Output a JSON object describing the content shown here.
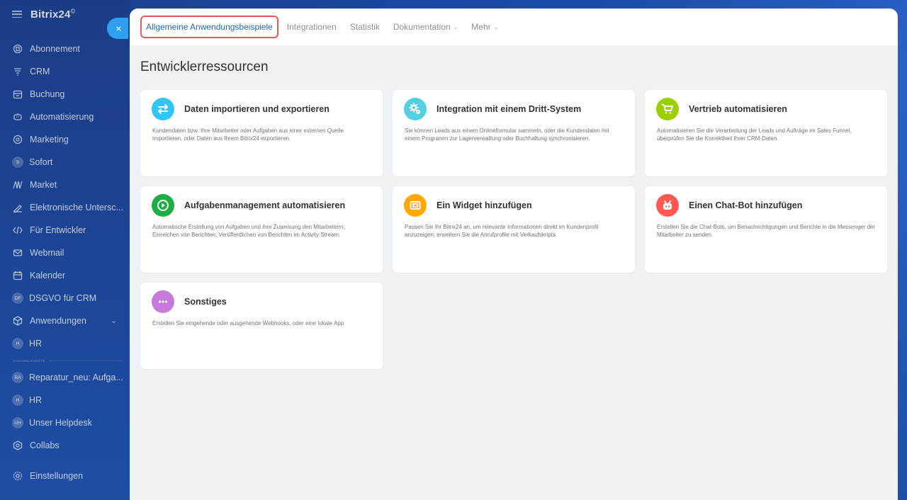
{
  "sidebar": {
    "logo": "Bitrix24",
    "logo_mark": "©",
    "items": [
      {
        "label": "Abonnement",
        "icon": "subscription-icon"
      },
      {
        "label": "CRM",
        "icon": "crm-icon"
      },
      {
        "label": "Buchung",
        "icon": "calendar-booking-icon"
      },
      {
        "label": "Automatisierung",
        "icon": "robot-icon"
      },
      {
        "label": "Marketing",
        "icon": "marketing-icon"
      },
      {
        "label": "Sofort",
        "icon": "s-badge",
        "badge": "S"
      },
      {
        "label": "Market",
        "icon": "market-icon"
      },
      {
        "label": "Elektronische Untersc...",
        "icon": "signature-icon"
      },
      {
        "label": "Für Entwickler",
        "icon": "code-icon"
      },
      {
        "label": "Webmail",
        "icon": "mail-icon"
      },
      {
        "label": "Kalender",
        "icon": "calendar-icon"
      },
      {
        "label": "DSGVO für CRM",
        "icon": "df-badge",
        "badge": "DF"
      },
      {
        "label": "Anwendungen",
        "icon": "apps-icon",
        "chevron": "⌄"
      },
      {
        "label": "HR",
        "icon": "h-badge",
        "badge": "H"
      }
    ],
    "divider_label": "AUSGEBLENDETE",
    "hidden_items": [
      {
        "label": "Reparatur_neu: Aufga...",
        "badge": "RA"
      },
      {
        "label": "HR",
        "badge": "H"
      },
      {
        "label": "Unser Helpdesk",
        "badge": "UH"
      },
      {
        "label": "Collabs",
        "icon": "collabs-icon"
      }
    ],
    "settings_label": "Einstellungen"
  },
  "close_button": "×",
  "topnav": {
    "tabs": [
      {
        "label": "Allgemeine Anwendungsbeispiele",
        "active": true
      },
      {
        "label": "Integrationen"
      },
      {
        "label": "Statistik"
      },
      {
        "label": "Dokumentation",
        "caret": "⌄"
      },
      {
        "label": "Mehr",
        "caret": "⌄"
      }
    ]
  },
  "page_title": "Entwicklerressourcen",
  "cards": [
    {
      "title": "Daten importieren und exportieren",
      "desc": "Kundendaten bzw. Ihre Mitarbeiter oder Aufgaben aus einer externen Quelle importieren, oder Daten aus Ihrem Bitrix24 exportieren.",
      "icon": "arrows-exchange-icon",
      "color": "#2fc6f6"
    },
    {
      "title": "Integration mit einem Dritt-System",
      "desc": "Sie können Leads aus einem Onlineformular sammeln, oder die Kundendaten mit einem Programm zur Lagerverwaltung oder Buchhaltung synchronisieren.",
      "icon": "gears-icon",
      "color": "#55d0e0"
    },
    {
      "title": "Vertrieb automatisieren",
      "desc": "Automatisieren Sie die Verarbeitung der Leads und Aufträge im Sales Funnel, überprüfen Sie die Korrektheit Ihrer CRM-Daten.",
      "icon": "cart-icon",
      "color": "#9dcf00"
    },
    {
      "title": "Aufgabenmanagement automatisieren",
      "desc": "Automatische Erstellung von Aufgaben und ihre Zuweisung den Mitarbeitern; Einreichen von Berichten; Veröffentlichen von Berichten im Activity Stream.",
      "icon": "play-icon",
      "color": "#1eae43"
    },
    {
      "title": "Ein Widget hinzufügen",
      "desc": "Passen Sie Ihr Bitrix24 an, um relevante Informationen direkt im Kundenprofil anzuzeigen; erweitern Sie die Anrufprofile mit Verkaufskripts.",
      "icon": "widget-icon",
      "color": "#ffa900"
    },
    {
      "title": "Einen Chat-Bot hinzufügen",
      "desc": "Erstellen Sie die Chat-Bots, um Benachrichtigungen und Berichte in die Messenger der Mitarbeiter zu senden.",
      "icon": "bot-icon",
      "color": "#ff5752"
    },
    {
      "title": "Sonstiges",
      "desc": "Erstellen Sie eingehende oder ausgehende Webhooks, oder eine lokale App",
      "icon": "more-dots-icon",
      "color": "#c57ad9"
    }
  ]
}
